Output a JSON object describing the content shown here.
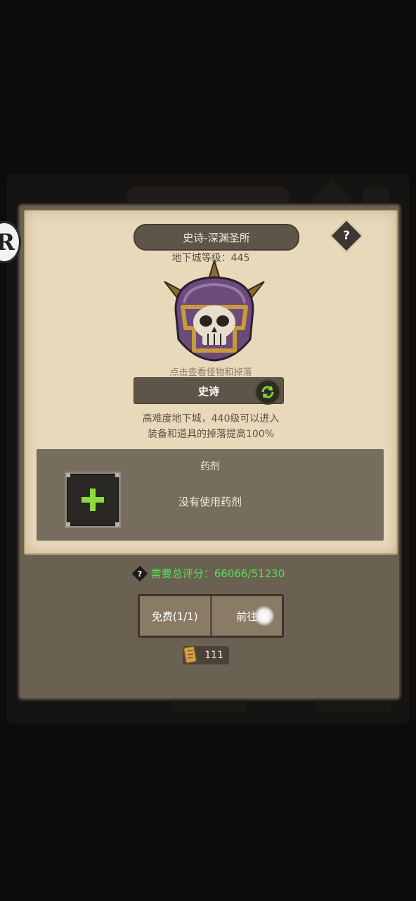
{
  "dungeon": {
    "title": "史诗-深渊圣所",
    "level_text": "地下城等级：445",
    "monster_hint": "点击查看怪物和掉落",
    "difficulty": "史诗",
    "desc_line1": "高难度地下城，440级可以进入",
    "desc_line2": "装备和道具的掉落提高100%",
    "help_symbol": "?"
  },
  "potion": {
    "title": "药剂",
    "empty_text": "没有使用药剂"
  },
  "requirement": {
    "text": "需要总评分：66066/51230",
    "color": "#54e254"
  },
  "actions": {
    "free_label": "免费(1/1)",
    "go_label": "前往"
  },
  "currency": {
    "ticket_count": "111"
  },
  "side_logo": "R"
}
